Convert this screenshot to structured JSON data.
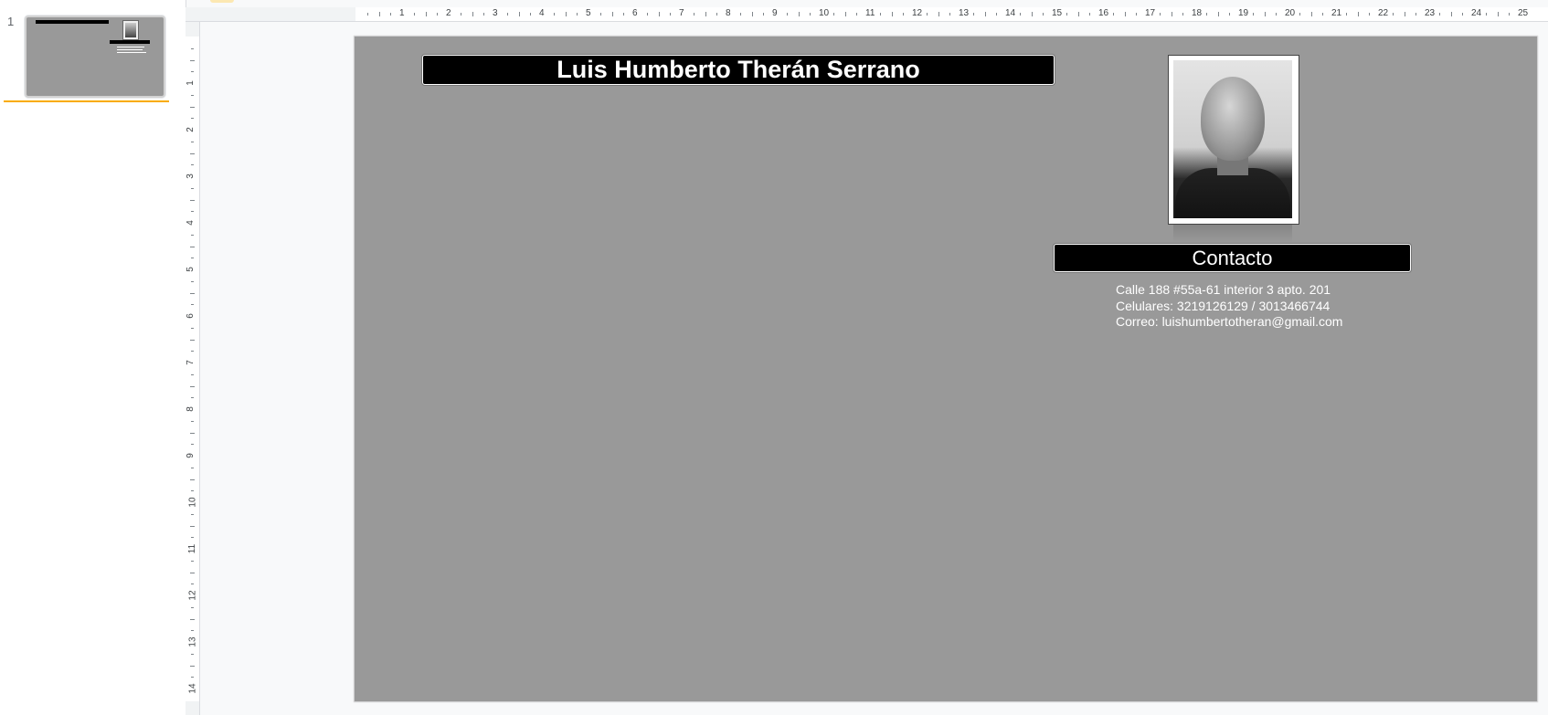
{
  "filmstrip": {
    "slide_number": "1"
  },
  "ruler": {
    "horizontal": [
      "1",
      "2",
      "3",
      "4",
      "5",
      "6",
      "7",
      "8",
      "9",
      "10",
      "11",
      "12",
      "13",
      "14",
      "15",
      "16",
      "17",
      "18",
      "19",
      "20",
      "21",
      "22",
      "23",
      "24",
      "25"
    ],
    "vertical": [
      "1",
      "2",
      "3",
      "4",
      "5",
      "6",
      "7",
      "8",
      "9",
      "10",
      "11",
      "12",
      "13",
      "14"
    ]
  },
  "slide": {
    "background": "#999999",
    "title": "Luis Humberto Therán Serrano",
    "contact_heading": "Contacto",
    "contact_lines": [
      "Calle 188 #55a-61 interior 3 apto. 201",
      "Celulares: 3219126129 / 3013466744",
      "Correo: luishumbertotheran@gmail.com"
    ]
  },
  "colors": {
    "accent": "#f9ab00",
    "bar": "#000000",
    "text_on_bar": "#ffffff"
  }
}
